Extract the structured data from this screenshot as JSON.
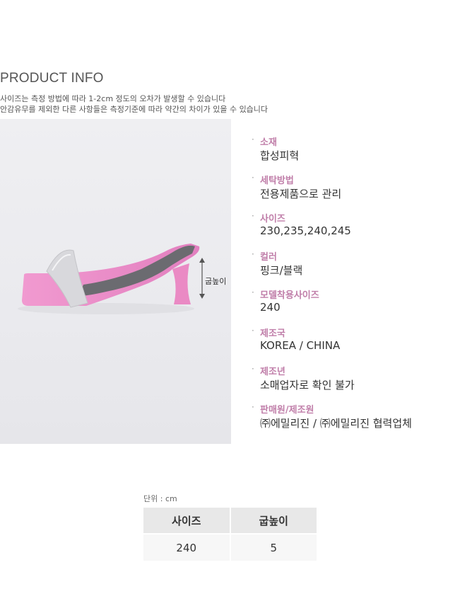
{
  "header": {
    "title": "PRODUCT INFO",
    "notice_1": "사이즈는 측정 방법에 따라 1-2cm 정도의 오차가 발생할 수 있습니다",
    "notice_2": "안감유무를 제외한 다른 사항들은 측정기준에 따라 약간의 차이가 있을 수 있습니다"
  },
  "photo": {
    "heel_label": "굽높이",
    "colors": {
      "sole": "#e88ac5",
      "strap": "#d8d8dc",
      "insole": "#6a6a6e",
      "background": "#ececef"
    }
  },
  "specs": {
    "bullet": "·",
    "items": [
      {
        "label": " 소재",
        "value": "합성피혁"
      },
      {
        "label": "세탁방법",
        "value": "전용제품으로 관리"
      },
      {
        "label": "사이즈",
        "value": "230,235,240,245"
      },
      {
        "label": "컬러",
        "value": "핑크/블랙"
      },
      {
        "label": "모델착용사이즈",
        "value": "240"
      },
      {
        "label": "제조국",
        "value": "KOREA / CHINA"
      },
      {
        "label": "제조년",
        "value": "소매업자로 확인 불가"
      },
      {
        "label": "판매원/제조원",
        "value": "㈜에밀리진 / ㈜에밀리진 협력업체"
      }
    ],
    "label_color": "#c07ea9"
  },
  "size_table": {
    "unit": "단위 : cm",
    "headers": [
      "사이즈",
      "굽높이"
    ],
    "rows": [
      [
        "240",
        "5"
      ]
    ]
  }
}
